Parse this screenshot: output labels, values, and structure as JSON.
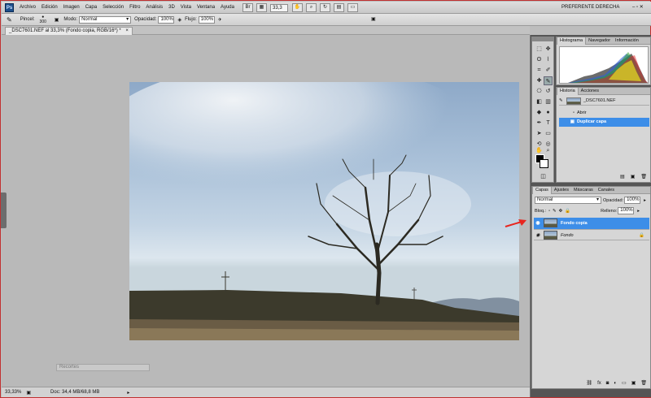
{
  "menubar": {
    "logo": "Ps",
    "items": [
      "Archivo",
      "Edición",
      "Imagen",
      "Capa",
      "Selección",
      "Filtro",
      "Análisis",
      "3D",
      "Vista",
      "Ventana",
      "Ayuda"
    ],
    "zoom": "33,3",
    "workspace": "PREFERENTE DERECHA",
    "window_controls": "–  ▫  ✕"
  },
  "options": {
    "brush_label": "Pincel:",
    "brush_size": "300",
    "mode_label": "Modo:",
    "mode_value": "Normal",
    "opacity_label": "Opacidad:",
    "opacity_value": "100%",
    "flow_label": "Flujo:",
    "flow_value": "100%"
  },
  "document": {
    "tab_title": "_DSC7601.NEF al 33,3% (Fondo copia, RGB/16*) *",
    "tab_close": "×"
  },
  "canvas": {
    "recortes": "Recortes"
  },
  "status": {
    "zoom": "33,33%",
    "doc": "Doc: 34,4 MB/68,8 MB"
  },
  "histogram": {
    "tabs": [
      "Histograma",
      "Navegador",
      "Información"
    ]
  },
  "history": {
    "tabs": [
      "Historia",
      "Acciones"
    ],
    "snapshot": "_DSC7601.NEF",
    "steps": [
      "Abrir",
      "Duplicar capa"
    ]
  },
  "layers": {
    "tabs": [
      "Capas",
      "Ajustes",
      "Máscaras",
      "Canales"
    ],
    "blend": "Normal",
    "opacity_label": "Opacidad:",
    "opacity_value": "100%",
    "lock_label": "Bloq.:",
    "fill_label": "Relleno:",
    "fill_value": "100%",
    "items": [
      {
        "name": "Fondo copia",
        "selected": true
      },
      {
        "name": "Fondo",
        "selected": false
      }
    ]
  },
  "colors": {
    "selection": "#3d8ee8",
    "arrow": "#e8251e"
  }
}
